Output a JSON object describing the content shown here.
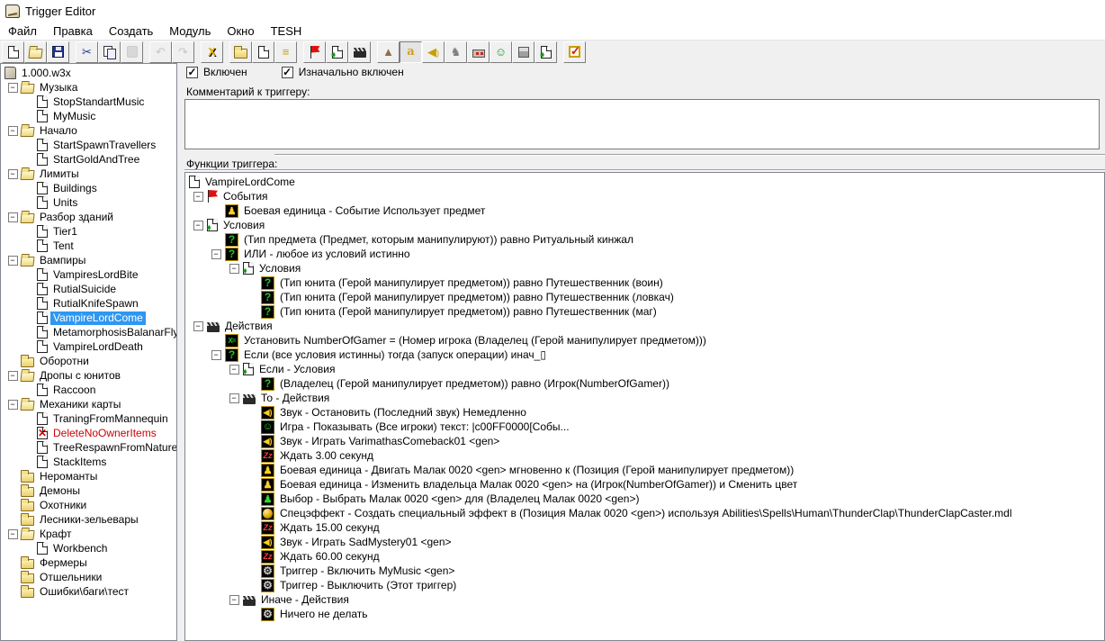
{
  "window": {
    "title": "Trigger Editor"
  },
  "menu": {
    "items": [
      "Файл",
      "Правка",
      "Создать",
      "Модуль",
      "Окно",
      "TESH"
    ]
  },
  "toolbar": {
    "groups": [
      [
        {
          "name": "new-map",
          "icon": "page"
        },
        {
          "name": "open-map",
          "icon": "open-folder"
        },
        {
          "name": "save-map",
          "icon": "floppy"
        }
      ],
      [
        {
          "name": "cut",
          "icon": "scissors"
        },
        {
          "name": "copy",
          "icon": "copy"
        },
        {
          "name": "paste",
          "icon": "paste",
          "disabled": true
        }
      ],
      [
        {
          "name": "undo",
          "icon": "undo-arrow",
          "disabled": true
        },
        {
          "name": "redo",
          "icon": "redo-arrow",
          "disabled": true
        }
      ],
      [
        {
          "name": "delete",
          "icon": "delete-x"
        }
      ],
      [
        {
          "name": "new-category",
          "icon": "folder"
        },
        {
          "name": "new-trigger",
          "icon": "page"
        },
        {
          "name": "new-comment",
          "icon": "comment-lines"
        }
      ],
      [
        {
          "name": "new-event",
          "icon": "event-flag"
        },
        {
          "name": "new-condition",
          "icon": "condition-page"
        },
        {
          "name": "new-action",
          "icon": "action-clapperboard"
        }
      ],
      [
        {
          "name": "terrain-editor",
          "icon": "mountain"
        },
        {
          "name": "trigger-editor",
          "icon": "letter-a",
          "pressed": true
        },
        {
          "name": "sound-editor",
          "icon": "speaker"
        },
        {
          "name": "object-editor",
          "icon": "object-figure"
        },
        {
          "name": "campaign-editor",
          "icon": "campaign-box"
        },
        {
          "name": "ai-editor",
          "icon": "green-face"
        },
        {
          "name": "object-manager",
          "icon": "cube"
        },
        {
          "name": "import-manager",
          "icon": "import-page"
        }
      ],
      [
        {
          "name": "check-trigger",
          "icon": "red-check"
        }
      ]
    ]
  },
  "right_panel": {
    "enabled_checkbox": {
      "label": "Включен",
      "checked": true
    },
    "initially_on_checkbox": {
      "label": "Изначально включен",
      "checked": true
    },
    "comment_label": "Комментарий к триггеру:",
    "comment_value": "",
    "functions_label": "Функции триггера:"
  },
  "left_tree": {
    "rows": [
      {
        "label": "1.000.w3x",
        "icon": "map",
        "level": 0
      },
      {
        "label": "Музыка",
        "icon": "folder-open",
        "level": 1,
        "exp": true
      },
      {
        "label": "StopStandartMusic",
        "icon": "page",
        "level": 2
      },
      {
        "label": "MyMusic",
        "icon": "page",
        "level": 2
      },
      {
        "label": "Начало",
        "icon": "folder-open",
        "level": 1,
        "exp": true
      },
      {
        "label": "StartSpawnTravellers",
        "icon": "page",
        "level": 2
      },
      {
        "label": "StartGoldAndTree",
        "icon": "page",
        "level": 2
      },
      {
        "label": "Лимиты",
        "icon": "folder-open",
        "level": 1,
        "exp": true
      },
      {
        "label": "Buildings",
        "icon": "page",
        "level": 2
      },
      {
        "label": "Units",
        "icon": "page",
        "level": 2
      },
      {
        "label": "Разбор зданий",
        "icon": "folder-open",
        "level": 1,
        "exp": true
      },
      {
        "label": "Tier1",
        "icon": "page",
        "level": 2
      },
      {
        "label": "Tent",
        "icon": "page",
        "level": 2
      },
      {
        "label": "Вампиры",
        "icon": "folder-open",
        "level": 1,
        "exp": true
      },
      {
        "label": "VampiresLordBite",
        "icon": "page",
        "level": 2
      },
      {
        "label": "RutialSuicide",
        "icon": "page",
        "level": 2
      },
      {
        "label": "RutialKnifeSpawn",
        "icon": "page",
        "level": 2
      },
      {
        "label": "VampireLordCome",
        "icon": "page",
        "level": 2,
        "selected": true
      },
      {
        "label": "MetamorphosisBalanarFly",
        "icon": "page",
        "level": 2
      },
      {
        "label": "VampireLordDeath",
        "icon": "page",
        "level": 2
      },
      {
        "label": "Оборотни",
        "icon": "folder",
        "level": 1
      },
      {
        "label": "Дропы с юнитов",
        "icon": "folder-open",
        "level": 1,
        "exp": true
      },
      {
        "label": "Raccoon",
        "icon": "page",
        "level": 2
      },
      {
        "label": "Механики карты",
        "icon": "folder-open",
        "level": 1,
        "exp": true
      },
      {
        "label": "TraningFromMannequin",
        "icon": "page",
        "level": 2
      },
      {
        "label": "DeleteNoOwnerItems",
        "icon": "page-x",
        "level": 2,
        "disabled": true
      },
      {
        "label": "TreeRespawnFromNature",
        "icon": "page",
        "level": 2
      },
      {
        "label": "StackItems",
        "icon": "page",
        "level": 2
      },
      {
        "label": "Нероманты",
        "icon": "folder",
        "level": 1
      },
      {
        "label": "Демоны",
        "icon": "folder",
        "level": 1
      },
      {
        "label": "Охотники",
        "icon": "folder",
        "level": 1
      },
      {
        "label": "Лесники-зельевары",
        "icon": "folder",
        "level": 1
      },
      {
        "label": "Крафт",
        "icon": "folder-open",
        "level": 1,
        "exp": true
      },
      {
        "label": "Workbench",
        "icon": "page",
        "level": 2
      },
      {
        "label": "Фермеры",
        "icon": "folder",
        "level": 1
      },
      {
        "label": "Отшельники",
        "icon": "folder",
        "level": 1
      },
      {
        "label": "Ошибки\\баги\\тест",
        "icon": "folder",
        "level": 1
      }
    ]
  },
  "functions_tree": {
    "rows": [
      {
        "label": "VampireLordCome",
        "icon": "page",
        "level": 0
      },
      {
        "label": "События",
        "icon": "flag",
        "level": 1,
        "exp": true
      },
      {
        "label": "Боевая единица - Событие Использует предмет",
        "icon": "unit",
        "level": 2
      },
      {
        "label": "Условия",
        "icon": "cond-page",
        "level": 1,
        "exp": true
      },
      {
        "label": "(Тип предмета (Предмет, которым манипулируют)) равно Ритуальный кинжал",
        "icon": "quest",
        "level": 2
      },
      {
        "label": "ИЛИ - любое из условий истинно",
        "icon": "quest",
        "level": 2,
        "exp": true
      },
      {
        "label": "Условия",
        "icon": "cond-page",
        "level": 3,
        "exp": true
      },
      {
        "label": "(Тип юнита (Герой манипулирует предметом)) равно Путешественник (воин)",
        "icon": "quest",
        "level": 4
      },
      {
        "label": "(Тип юнита (Герой манипулирует предметом)) равно Путешественник (ловкач)",
        "icon": "quest",
        "level": 4
      },
      {
        "label": "(Тип юнита (Герой манипулирует предметом)) равно Путешественник (маг)",
        "icon": "quest",
        "level": 4
      },
      {
        "label": "Действия",
        "icon": "clap",
        "level": 1,
        "exp": true
      },
      {
        "label": "Установить NumberOfGamer = (Номер игрока (Владелец (Герой манипулирует предметом)))",
        "icon": "setvar",
        "level": 2
      },
      {
        "label": "Если (все условия истинны) тогда (запуск операции) инач_▯",
        "icon": "quest",
        "level": 2,
        "exp": true
      },
      {
        "label": "Если - Условия",
        "icon": "cond-page",
        "level": 3,
        "exp": true
      },
      {
        "label": "(Владелец (Герой манипулирует предметом)) равно (Игрок(NumberOfGamer))",
        "icon": "quest",
        "level": 4
      },
      {
        "label": "То - Действия",
        "icon": "clap",
        "level": 3,
        "exp": true
      },
      {
        "label": "Звук - Остановить (Последний звук) Немедленно",
        "icon": "sound",
        "level": 4
      },
      {
        "label": "Игра - Показывать (Все игроки) текст: |c00FF0000[Собы...",
        "icon": "game",
        "level": 4
      },
      {
        "label": "Звук - Играть VarimathasComeback01 <gen>",
        "icon": "sound",
        "level": 4
      },
      {
        "label": "Ждать 3.00 секунд",
        "icon": "wait",
        "level": 4
      },
      {
        "label": "Боевая единица - Двигать Малак 0020 <gen> мгновенно к (Позиция (Герой манипулирует предметом))",
        "icon": "unit",
        "level": 4
      },
      {
        "label": "Боевая единица - Изменить владельца Малак 0020 <gen> на (Игрок(NumberOfGamer)) и Сменить цвет",
        "icon": "unit",
        "level": 4
      },
      {
        "label": "Выбор - Выбрать Малак 0020 <gen> для (Владелец Малак 0020 <gen>)",
        "icon": "select",
        "level": 4
      },
      {
        "label": "Спецэффект - Создать специальный эффект в (Позиция Малак 0020 <gen>) используя Abilities\\Spells\\Human\\ThunderClap\\ThunderClapCaster.mdl",
        "icon": "orb",
        "level": 4
      },
      {
        "label": "Ждать 15.00 секунд",
        "icon": "wait",
        "level": 4
      },
      {
        "label": "Звук - Играть SadMystery01 <gen>",
        "icon": "sound",
        "level": 4
      },
      {
        "label": "Ждать 60.00 секунд",
        "icon": "wait",
        "level": 4
      },
      {
        "label": "Триггер - Включить MyMusic <gen>",
        "icon": "gear",
        "level": 4
      },
      {
        "label": "Триггер - Выключить (Этот триггер)",
        "icon": "gear",
        "level": 4
      },
      {
        "label": "Иначе - Действия",
        "icon": "clap",
        "level": 3,
        "exp": true
      },
      {
        "label": "Ничего не делать",
        "icon": "gear",
        "level": 4
      }
    ]
  },
  "colors": {
    "selection": "#2e97f2",
    "disabled_trigger_text": "#cc0000",
    "toolbar_bg": "#f0f0f0"
  }
}
